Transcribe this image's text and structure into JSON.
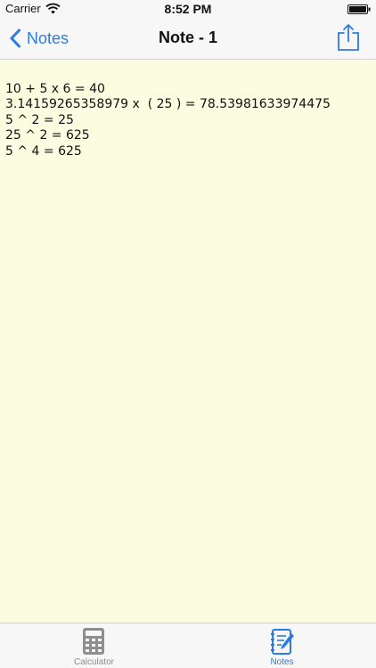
{
  "status_bar": {
    "carrier": "Carrier",
    "time": "8:52 PM"
  },
  "nav": {
    "back_label": "Notes",
    "title": "Note - 1"
  },
  "note": {
    "lines": [
      "10 + 5 x 6 = 40",
      "3.14159265358979 x  ( 25 ) = 78.53981633974475",
      "5 ^ 2 = 25",
      "25 ^ 2 = 625",
      "5 ^ 4 = 625"
    ]
  },
  "tabs": [
    {
      "label": "Calculator",
      "icon": "calculator-icon",
      "selected": false
    },
    {
      "label": "Notes",
      "icon": "notes-icon",
      "selected": true
    }
  ],
  "colors": {
    "accent": "#2d7be0",
    "note_background": "#fafde0",
    "inactive_tab": "#8e8e8e"
  }
}
